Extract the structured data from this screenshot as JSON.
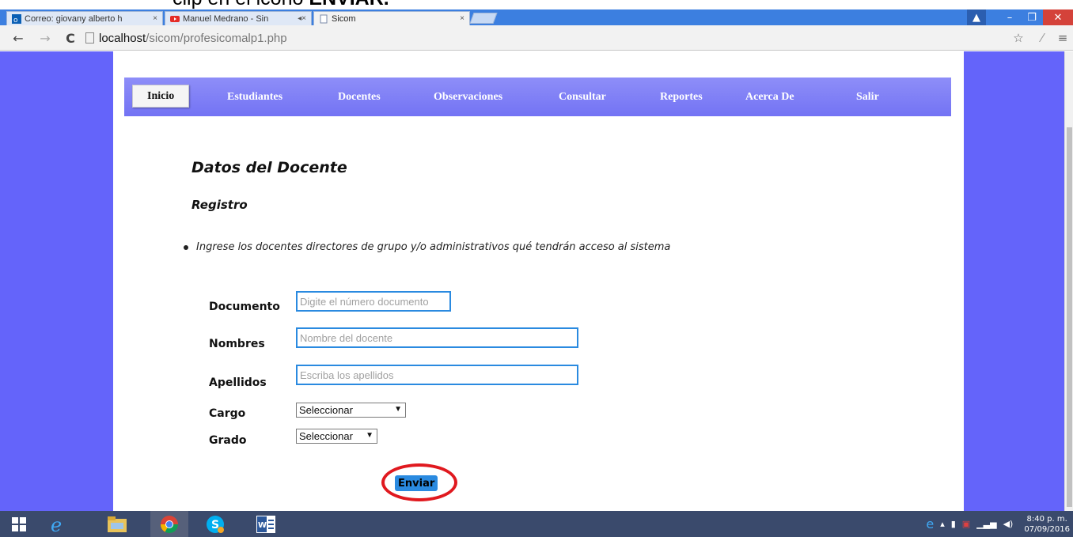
{
  "caption": {
    "text": "clip en el icono ",
    "emph": "ENVIAR."
  },
  "tabs": [
    {
      "label": "Correo: giovany alberto h",
      "icon": "outlook-icon",
      "close": "×"
    },
    {
      "label": "Manuel Medrano - Sin",
      "icon": "youtube-icon",
      "close": "◂× "
    },
    {
      "label": "Sicom",
      "icon": "page-icon",
      "close": "×"
    }
  ],
  "window": {
    "minimize": "–",
    "restore": "❐",
    "close": "✕",
    "user": "▲"
  },
  "address": {
    "host": "localhost",
    "path": "/sicom/profesicomalp1.php",
    "back": "←",
    "forward": "→",
    "reload": "C",
    "star": "☆",
    "menu": "≡"
  },
  "nav": {
    "items": [
      {
        "label": "Inicio"
      },
      {
        "label": "Estudiantes"
      },
      {
        "label": "Docentes"
      },
      {
        "label": "Observaciones"
      },
      {
        "label": "Consultar"
      },
      {
        "label": "Reportes"
      },
      {
        "label": "Acerca De"
      },
      {
        "label": "Salir"
      }
    ]
  },
  "page": {
    "title": "Datos del Docente",
    "subtitle": "Registro",
    "instruction": "Ingrese los docentes directores de grupo y/o administrativos qué tendrán acceso al sistema"
  },
  "form": {
    "documento": {
      "label": "Documento",
      "placeholder": "Digite el número documento"
    },
    "nombres": {
      "label": "Nombres",
      "placeholder": "Nombre del docente"
    },
    "apellidos": {
      "label": "Apellidos",
      "placeholder": "Escriba los apellidos"
    },
    "cargo": {
      "label": "Cargo",
      "value": "Seleccionar"
    },
    "grado": {
      "label": "Grado",
      "value": "Seleccionar"
    },
    "submit": "Enviar",
    "arrow": "▼"
  },
  "taskbar": {
    "time": "8:40 p. m.",
    "date": "07/09/2016",
    "apps": [
      "start-icon",
      "ie-icon",
      "explorer-icon",
      "chrome-icon",
      "skype-icon",
      "word-icon"
    ]
  },
  "colors": {
    "page_bg": "#6464fa",
    "nav": "#7a7af6",
    "input_border": "#2a8ae0",
    "button": "#2a8ae0",
    "highlight": "#e0191f"
  }
}
